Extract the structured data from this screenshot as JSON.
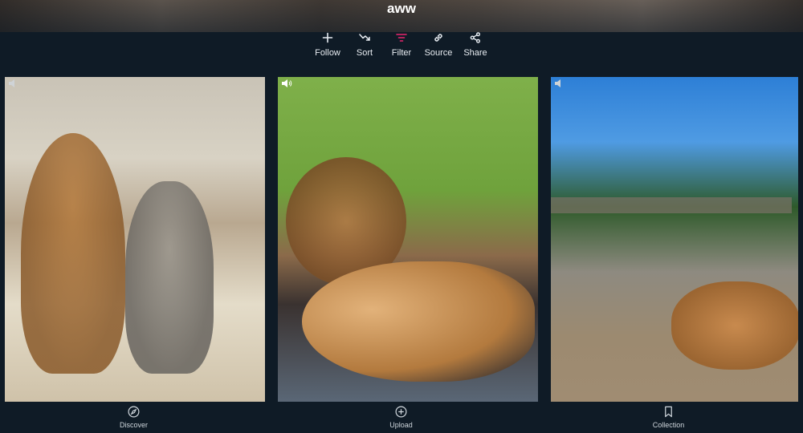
{
  "header": {
    "title": "aww"
  },
  "toolbar": {
    "items": [
      {
        "label": "Follow",
        "icon": "plus-icon"
      },
      {
        "label": "Sort",
        "icon": "trend-down-icon"
      },
      {
        "label": "Filter",
        "icon": "filter-icon",
        "active_color": "#e8266d"
      },
      {
        "label": "Source",
        "icon": "link-icon"
      },
      {
        "label": "Share",
        "icon": "share-icon"
      }
    ]
  },
  "videos": [
    {
      "icon": "speaker-icon",
      "muted": true
    },
    {
      "icon": "speaker-icon",
      "muted": false
    },
    {
      "icon": "speaker-icon",
      "muted": true
    }
  ],
  "bottom_nav": {
    "items": [
      {
        "label": "Discover",
        "icon": "compass-icon"
      },
      {
        "label": "Upload",
        "icon": "upload-plus-icon"
      },
      {
        "label": "Collection",
        "icon": "bookmark-icon"
      }
    ]
  }
}
